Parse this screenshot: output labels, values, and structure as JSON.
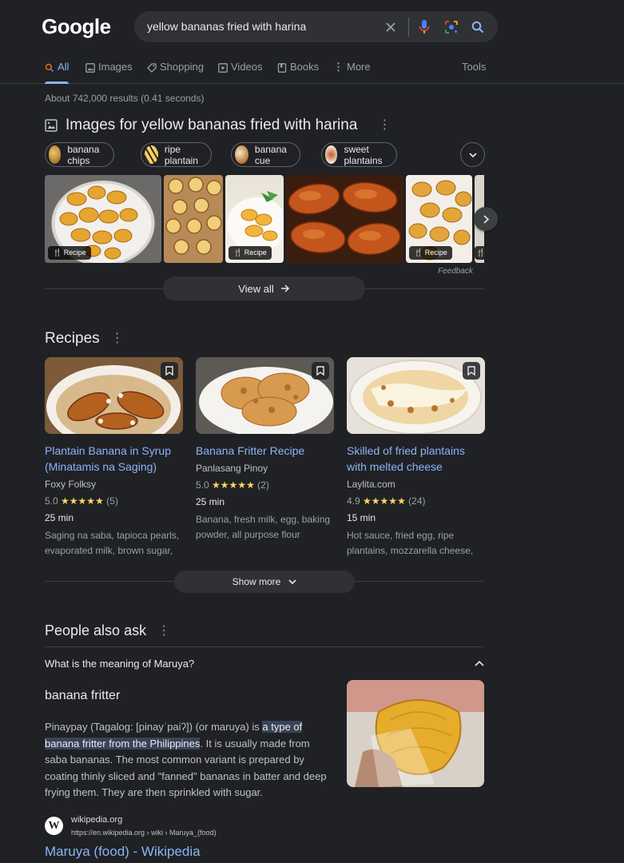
{
  "header": {
    "logo": "Google",
    "search_value": "yellow bananas fried with harina"
  },
  "tabs": [
    {
      "label": "All",
      "icon": "search-icon",
      "active": true
    },
    {
      "label": "Images",
      "icon": "image-icon"
    },
    {
      "label": "Shopping",
      "icon": "tag-icon"
    },
    {
      "label": "Videos",
      "icon": "play-icon"
    },
    {
      "label": "Books",
      "icon": "book-icon"
    },
    {
      "label": "More",
      "icon": "kebab-icon"
    }
  ],
  "tools_label": "Tools",
  "result_stats": "About 742,000 results (0.41 seconds)",
  "images_section": {
    "title": "Images for yellow bananas fried with harina",
    "chips": [
      "banana chips",
      "ripe plantain",
      "banana cue",
      "sweet plantains"
    ],
    "recipe_tag": "Recipe",
    "feedback": "Feedback",
    "view_all": "View all"
  },
  "recipes_section": {
    "title": "Recipes",
    "cards": [
      {
        "title": "Plantain Banana in Syrup (Minatamis na Saging)",
        "source": "Foxy Folksy",
        "rating": "5.0",
        "stars": "★★★★★",
        "reviews": "(5)",
        "time": "25 min",
        "ingredients": "Saging na saba, tapioca pearls, evaporated milk, brown sugar,"
      },
      {
        "title": "Banana Fritter Recipe",
        "source": "Panlasang Pinoy",
        "rating": "5.0",
        "stars": "★★★★★",
        "reviews": "(2)",
        "time": "25 min",
        "ingredients": "Banana, fresh milk, egg, baking powder, all purpose flour"
      },
      {
        "title": "Skilled of fried plantains with melted cheese",
        "source": "Laylita.com",
        "rating": "4.9",
        "stars": "★★★★★",
        "reviews": "(24)",
        "time": "15 min",
        "ingredients": "Hot sauce, fried egg, ripe plantains, mozzarella cheese,"
      }
    ],
    "show_more": "Show more"
  },
  "paa": {
    "title": "People also ask",
    "question": "What is the meaning of Maruya?",
    "answer_title": "banana fritter",
    "answer_pre": "Pinaypay (Tagalog: [pinayˈpaiʔ]) (or maruya) is ",
    "answer_highlight": "a type of banana fritter from the Philippines",
    "answer_post": ". It is usually made from saba bananas. The most common variant is prepared by coating thinly sliced and \"fanned\" bananas in batter and deep frying them. They are then sprinkled with sugar.",
    "source_site": "wikipedia.org",
    "source_url": "https://en.wikipedia.org › wiki › Maruya_(food)",
    "source_favicon": "W",
    "source_title": "Maruya (food) - Wikipedia"
  },
  "colors": {
    "background": "#202124",
    "link": "#8ab4f8",
    "star": "#fdd663",
    "highlight": "#394457"
  }
}
